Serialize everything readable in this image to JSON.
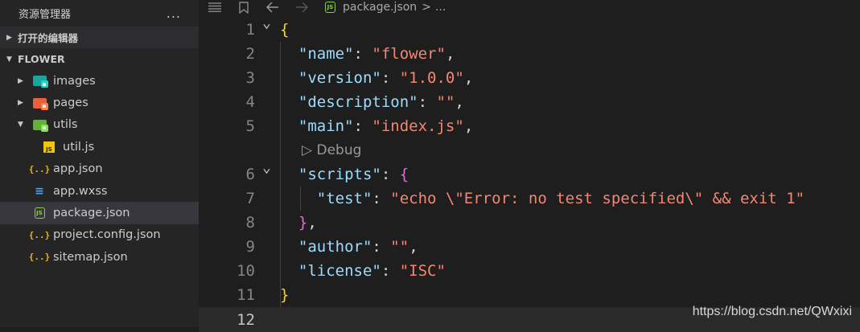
{
  "explorer": {
    "title": "资源管理器",
    "more": "...",
    "open_editors_label": "打开的编辑器",
    "project_label": "FLOWER",
    "tree": [
      {
        "name": "images",
        "kind": "folder",
        "icon": "images-folder-icon",
        "indent": 0,
        "expanded": false
      },
      {
        "name": "pages",
        "kind": "folder",
        "icon": "pages-folder-icon",
        "indent": 0,
        "expanded": false
      },
      {
        "name": "utils",
        "kind": "folder",
        "icon": "utils-folder-icon",
        "indent": 0,
        "expanded": true
      },
      {
        "name": "util.js",
        "kind": "js",
        "icon": "js-file-icon",
        "indent": 1
      },
      {
        "name": "app.json",
        "kind": "json",
        "icon": "json-file-icon",
        "indent": 0
      },
      {
        "name": "app.wxss",
        "kind": "css",
        "icon": "css-file-icon",
        "indent": 0
      },
      {
        "name": "package.json",
        "kind": "node",
        "icon": "nodejs-file-icon",
        "indent": 0,
        "selected": true
      },
      {
        "name": "project.config.json",
        "kind": "json",
        "icon": "json-file-icon",
        "indent": 0
      },
      {
        "name": "sitemap.json",
        "kind": "json",
        "icon": "json-file-icon",
        "indent": 0
      }
    ]
  },
  "breadcrumb": {
    "file": "package.json",
    "separator": ">",
    "tail": "..."
  },
  "editor": {
    "codelens": "Debug",
    "lines": [
      {
        "n": "1",
        "tokens": [
          [
            "b1",
            "{"
          ]
        ]
      },
      {
        "n": "2",
        "tokens": [
          [
            "p",
            "  "
          ],
          [
            "k",
            "\"name\""
          ],
          [
            "p",
            ": "
          ],
          [
            "s",
            "\"flower\""
          ],
          [
            "p",
            ","
          ]
        ]
      },
      {
        "n": "3",
        "tokens": [
          [
            "p",
            "  "
          ],
          [
            "k",
            "\"version\""
          ],
          [
            "p",
            ": "
          ],
          [
            "s",
            "\"1.0.0\""
          ],
          [
            "p",
            ","
          ]
        ]
      },
      {
        "n": "4",
        "tokens": [
          [
            "p",
            "  "
          ],
          [
            "k",
            "\"description\""
          ],
          [
            "p",
            ": "
          ],
          [
            "s",
            "\"\""
          ],
          [
            "p",
            ","
          ]
        ]
      },
      {
        "n": "5",
        "tokens": [
          [
            "p",
            "  "
          ],
          [
            "k",
            "\"main\""
          ],
          [
            "p",
            ": "
          ],
          [
            "s",
            "\"index.js\""
          ],
          [
            "p",
            ","
          ]
        ]
      },
      {
        "n": "6",
        "tokens": [
          [
            "p",
            "  "
          ],
          [
            "k",
            "\"scripts\""
          ],
          [
            "p",
            ": "
          ],
          [
            "b2",
            "{"
          ]
        ]
      },
      {
        "n": "7",
        "tokens": [
          [
            "p",
            "    "
          ],
          [
            "k",
            "\"test\""
          ],
          [
            "p",
            ": "
          ],
          [
            "s",
            "\"echo \\\"Error: no test specified\\\" && exit 1\""
          ]
        ]
      },
      {
        "n": "8",
        "tokens": [
          [
            "p",
            "  "
          ],
          [
            "b2",
            "}"
          ],
          [
            "p",
            ","
          ]
        ]
      },
      {
        "n": "9",
        "tokens": [
          [
            "p",
            "  "
          ],
          [
            "k",
            "\"author\""
          ],
          [
            "p",
            ": "
          ],
          [
            "s",
            "\"\""
          ],
          [
            "p",
            ","
          ]
        ]
      },
      {
        "n": "10",
        "tokens": [
          [
            "p",
            "  "
          ],
          [
            "k",
            "\"license\""
          ],
          [
            "p",
            ": "
          ],
          [
            "s",
            "\"ISC\""
          ]
        ]
      },
      {
        "n": "11",
        "tokens": [
          [
            "b1",
            "}"
          ]
        ]
      },
      {
        "n": "12",
        "tokens": []
      }
    ]
  },
  "watermark": "https://blog.csdn.net/QWxixi",
  "colors": {
    "images_folder": "#1ba39c",
    "pages_folder": "#e8613c",
    "utils_folder": "#5fb236"
  }
}
